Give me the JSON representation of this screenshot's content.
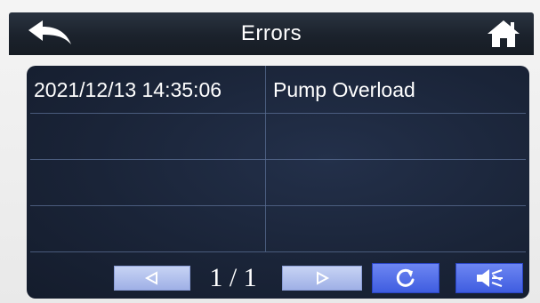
{
  "header": {
    "title": "Errors",
    "back_icon": "back-arrow-icon",
    "home_icon": "home-icon"
  },
  "errors": {
    "rows": [
      {
        "datetime": "2021/12/13  14:35:06",
        "message": "Pump  Overload"
      },
      {
        "datetime": "",
        "message": ""
      },
      {
        "datetime": "",
        "message": ""
      },
      {
        "datetime": "",
        "message": ""
      }
    ]
  },
  "footer": {
    "prev_icon": "triangle-left-icon",
    "page_indicator": "1 / 1",
    "next_icon": "triangle-right-icon",
    "refresh_icon": "refresh-icon",
    "mute_icon": "speaker-mute-icon"
  },
  "colors": {
    "titlebar": "#1b222c",
    "panel": "#1a2438",
    "grid": "#5b6f94",
    "nav_button": "#b3c1ee",
    "action_button": "#4f6ce8"
  }
}
